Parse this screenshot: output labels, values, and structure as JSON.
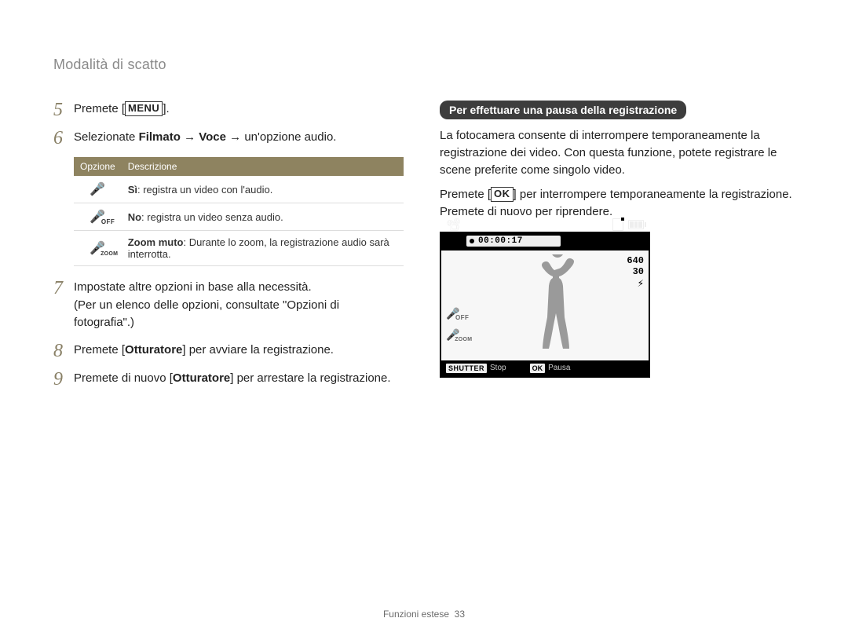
{
  "page_title": "Modalità di scatto",
  "steps": {
    "s5": {
      "num": "5",
      "pre": "Premete [",
      "btn": "MENU",
      "post": "]."
    },
    "s6": {
      "num": "6",
      "pre": "Selezionate ",
      "boldA": "Filmato",
      "arrow1": " → ",
      "boldB": "Voce",
      "arrow2": " → un'opzione audio."
    },
    "s7": {
      "num": "7",
      "line1": "Impostate altre opzioni in base alla necessità.",
      "line2": "(Per un elenco delle opzioni, consultate \"Opzioni di fotografia\".)"
    },
    "s8": {
      "num": "8",
      "pre": "Premete [",
      "bold": "Otturatore",
      "post": "] per avviare la registrazione."
    },
    "s9": {
      "num": "9",
      "pre": "Premete di nuovo [",
      "bold": "Otturatore",
      "post": "] per arrestare la registrazione."
    }
  },
  "option_table": {
    "col_opt": "Opzione",
    "col_desc": "Descrizione",
    "rows": [
      {
        "icon": "mic-on",
        "label": "Sì",
        "text": ": registra un video con l'audio."
      },
      {
        "icon": "mic-off",
        "label": "No",
        "text": ": registra un video senza audio."
      },
      {
        "icon": "mic-zoom",
        "label": "Zoom muto",
        "text": ": Durante lo zoom, la registrazione audio sarà interrotta."
      }
    ]
  },
  "right": {
    "pill": "Per effettuare una pausa della registrazione",
    "para1": "La fotocamera consente di interrompere temporaneamente la registrazione dei video. Con questa funzione, potete registrare le scene preferite come singolo video.",
    "para2_pre": "Premete [",
    "para2_btn": "OK",
    "para2_post": "] per interrompere temporaneamente la registrazione. Premete di nuovo per riprendere."
  },
  "lcd": {
    "time": "00:00:17",
    "res": "640",
    "fps": "30",
    "bottom_stop": "Stop",
    "bottom_pause": "Pausa",
    "shutter_tag": "SHUTTER",
    "ok_tag": "OK"
  },
  "footer": {
    "label": "Funzioni estese",
    "page": "33"
  }
}
